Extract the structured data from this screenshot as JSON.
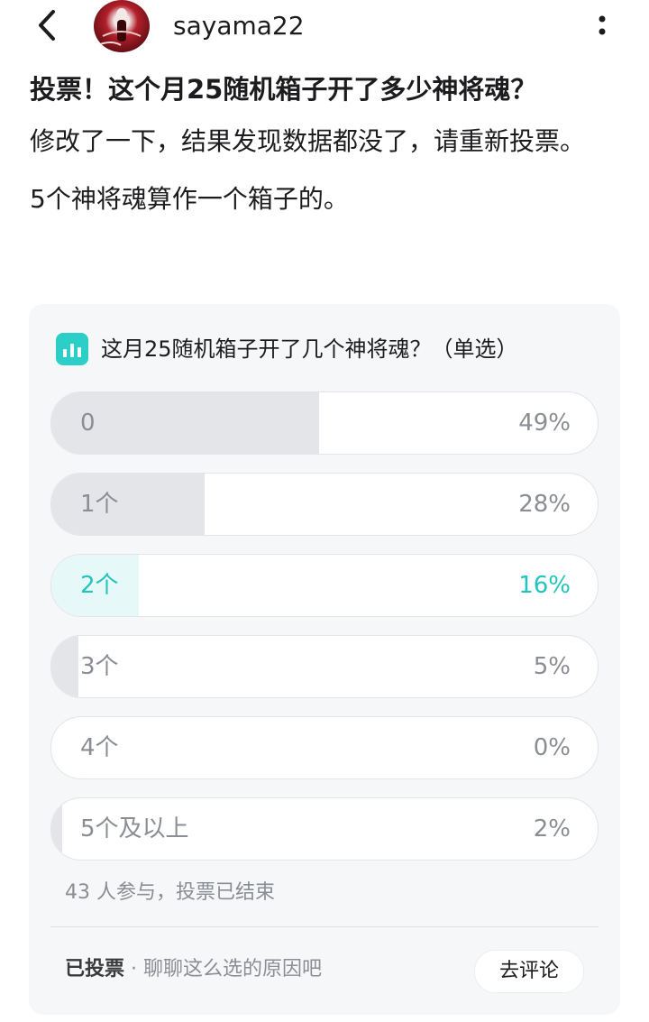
{
  "header": {
    "back_icon": "chevron-left-icon",
    "avatar_icon": "user-avatar",
    "username": "sayama22",
    "more_icon": "vertical-ellipsis-icon"
  },
  "post": {
    "title": "投票！这个月25随机箱子开了多少神将魂？",
    "body_line1": "修改了一下，结果发现数据都没了，请重新投票。",
    "body_line2": "5个神将魂算作一个箱子的。"
  },
  "poll": {
    "icon": "bar-chart-icon",
    "question": "这月25随机箱子开了几个神将魂？（单选）",
    "options": [
      {
        "label": "0",
        "percent_text": "49%",
        "percent": 49,
        "selected": false
      },
      {
        "label": "1个",
        "percent_text": "28%",
        "percent": 28,
        "selected": false
      },
      {
        "label": "2个",
        "percent_text": "16%",
        "percent": 16,
        "selected": true
      },
      {
        "label": "3个",
        "percent_text": "5%",
        "percent": 5,
        "selected": false
      },
      {
        "label": "4个",
        "percent_text": "0%",
        "percent": 0,
        "selected": false
      },
      {
        "label": "5个及以上",
        "percent_text": "2%",
        "percent": 2,
        "selected": false
      }
    ],
    "status": "43 人参与，投票已结束",
    "voted_label": "已投票",
    "separator": " · ",
    "footer_prompt": "聊聊这么选的原因吧",
    "comment_button": "去评论"
  },
  "colors": {
    "accent": "#22c4bc",
    "poll_icon_bg": "#2ccfc7",
    "bar_fill": "#e3e5e9",
    "selected_bar_fill": "#e6f8f7",
    "card_bg": "#f6f7f9",
    "muted_text": "#8a8d93"
  }
}
